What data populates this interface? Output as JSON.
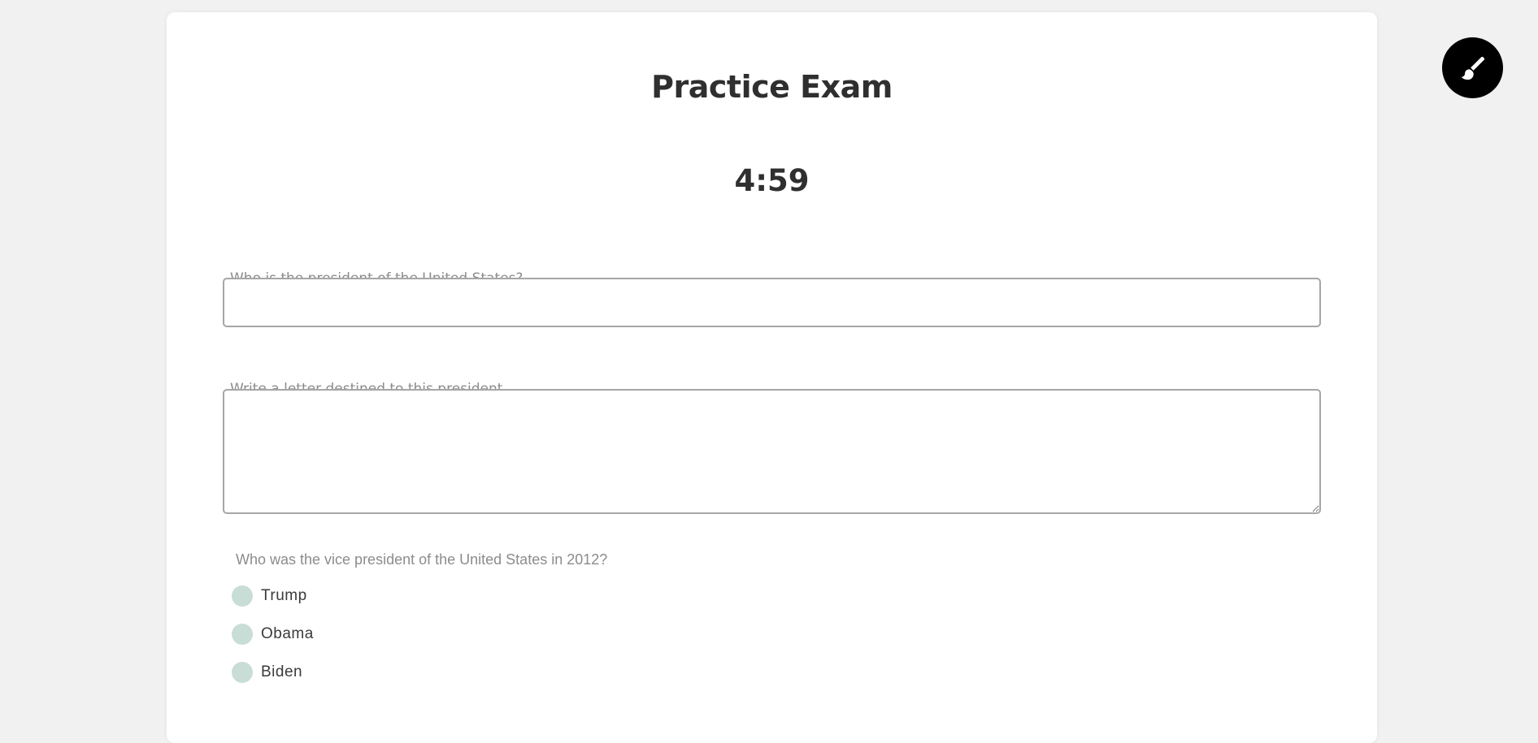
{
  "exam": {
    "title": "Practice Exam",
    "timer": "4:59"
  },
  "questions": {
    "q1": {
      "label": "Who is the president of the United States?",
      "value": ""
    },
    "q2": {
      "label": "Write a letter destined to this president",
      "value": ""
    },
    "q3": {
      "label": "Who was the vice president of the United States in 2012?",
      "options": [
        "Trump",
        "Obama",
        "Biden"
      ]
    }
  },
  "theme_button": {
    "icon": "paintbrush-icon"
  },
  "colors": {
    "background": "#f1f1f1",
    "card": "#ffffff",
    "radio": "#c8ddd6",
    "theme_button": "#000000"
  }
}
